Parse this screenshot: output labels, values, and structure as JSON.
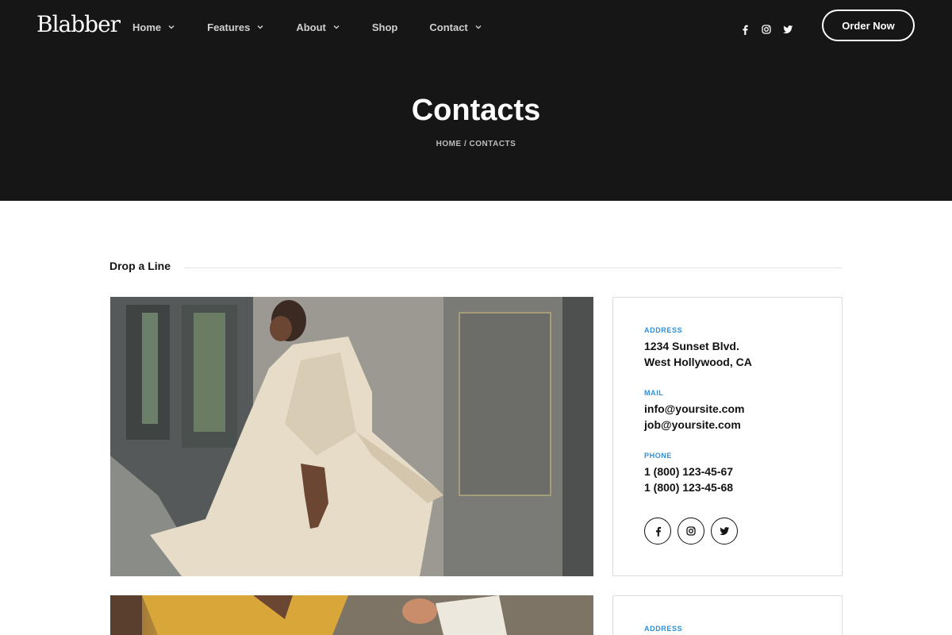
{
  "header": {
    "logo": "Blabber",
    "nav": [
      {
        "label": "Home",
        "has_dropdown": true
      },
      {
        "label": "Features",
        "has_dropdown": true
      },
      {
        "label": "About",
        "has_dropdown": true
      },
      {
        "label": "Shop",
        "has_dropdown": false
      },
      {
        "label": "Contact",
        "has_dropdown": true
      }
    ],
    "socials": [
      "facebook-icon",
      "instagram-icon",
      "twitter-icon"
    ],
    "order_button": "Order Now"
  },
  "hero": {
    "title": "Contacts",
    "breadcrumb": {
      "home": "HOME",
      "separator": "/",
      "current": "CONTACTS"
    }
  },
  "section": {
    "heading": "Drop a Line"
  },
  "contact_card": {
    "address_label": "ADDRESS",
    "address_lines": [
      "1234 Sunset Blvd.",
      "West Hollywood, CA"
    ],
    "mail_label": "MAIL",
    "mail_lines": [
      "info@yoursite.com",
      "job@yoursite.com"
    ],
    "phone_label": "PHONE",
    "phone_lines": [
      "1 (800) 123-45-67",
      "1 (800) 123-45-68"
    ],
    "socials": [
      "facebook-icon",
      "instagram-icon",
      "twitter-icon"
    ]
  },
  "contact_card_2": {
    "address_label": "ADDRESS"
  },
  "colors": {
    "hero_bg": "#161616",
    "accent_label": "#2f8fd8",
    "text": "#121212"
  }
}
